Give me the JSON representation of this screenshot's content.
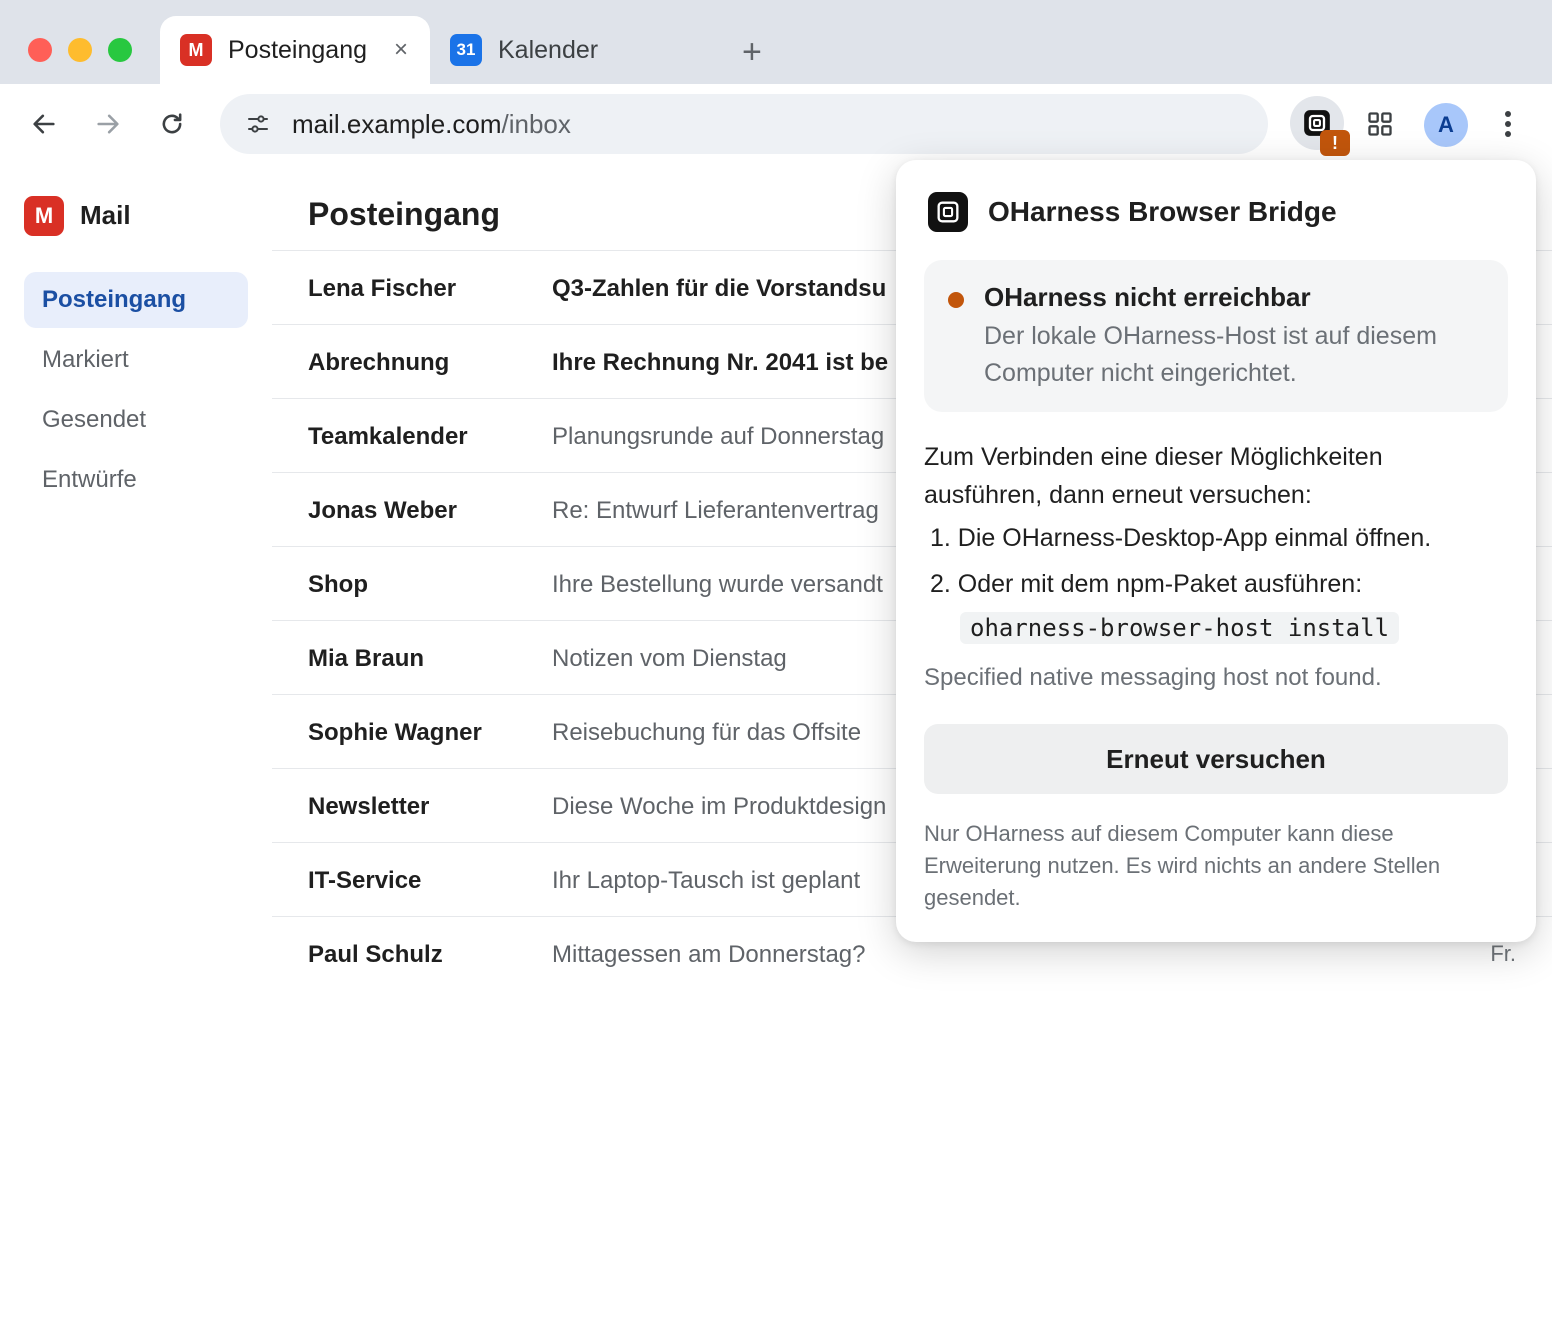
{
  "browser": {
    "tabs": [
      {
        "label": "Posteingang",
        "favicon": "M",
        "active": true,
        "close": "×"
      },
      {
        "label": "Kalender",
        "favicon": "31",
        "active": false
      }
    ],
    "new_tab": "+",
    "url_host": "mail.example.com",
    "url_path": "/inbox",
    "badge": "!",
    "avatar": "A",
    "colors": {
      "badge": "#c2560c",
      "avatar": "#a8c7fa",
      "tabstrip": "#dfe3ea"
    }
  },
  "app": {
    "logo": "M",
    "name": "Mail",
    "nav": [
      {
        "label": "Posteingang",
        "active": true
      },
      {
        "label": "Markiert",
        "active": false
      },
      {
        "label": "Gesendet",
        "active": false
      },
      {
        "label": "Entwürfe",
        "active": false
      }
    ],
    "inbox_title": "Posteingang",
    "messages": [
      {
        "sender": "Lena Fischer",
        "subject": "Q3-Zahlen für die Vorstandsu",
        "unread": true,
        "date": ""
      },
      {
        "sender": "Abrechnung",
        "subject": "Ihre Rechnung Nr. 2041 ist be",
        "unread": true,
        "date": ""
      },
      {
        "sender": "Teamkalender",
        "subject": "Planungsrunde auf Donnerstag",
        "unread": false,
        "date": ""
      },
      {
        "sender": "Jonas Weber",
        "subject": "Re: Entwurf Lieferantenvertrag",
        "unread": false,
        "date": ""
      },
      {
        "sender": "Shop",
        "subject": "Ihre Bestellung wurde versandt",
        "unread": false,
        "date": ""
      },
      {
        "sender": "Mia Braun",
        "subject": "Notizen vom Dienstag",
        "unread": false,
        "date": ""
      },
      {
        "sender": "Sophie Wagner",
        "subject": "Reisebuchung für das Offsite",
        "unread": false,
        "date": ""
      },
      {
        "sender": "Newsletter",
        "subject": "Diese Woche im Produktdesign",
        "unread": false,
        "date": ""
      },
      {
        "sender": "IT-Service",
        "subject": "Ihr Laptop-Tausch ist geplant",
        "unread": false,
        "date": ""
      },
      {
        "sender": "Paul Schulz",
        "subject": "Mittagessen am Donnerstag?",
        "unread": false,
        "date": "Fr."
      }
    ]
  },
  "popup": {
    "title": "OHarness Browser Bridge",
    "status_title": "OHarness nicht erreichbar",
    "status_desc": "Der lokale OHarness-Host ist auf diesem Computer nicht eingerichtet.",
    "status_color": "#c2560c",
    "instructions": "Zum Verbinden eine dieser Möglichkeiten ausführen, dann erneut versuchen:",
    "step1": "1. Die OHarness-Desktop-App einmal öffnen.",
    "step2": "2. Oder mit dem npm-Paket ausführen:",
    "command": "oharness-browser-host install",
    "error": "Specified native messaging host not found.",
    "retry": "Erneut versuchen",
    "footer": "Nur OHarness auf diesem Computer kann diese Erweiterung nutzen. Es wird nichts an andere Stellen gesendet."
  }
}
